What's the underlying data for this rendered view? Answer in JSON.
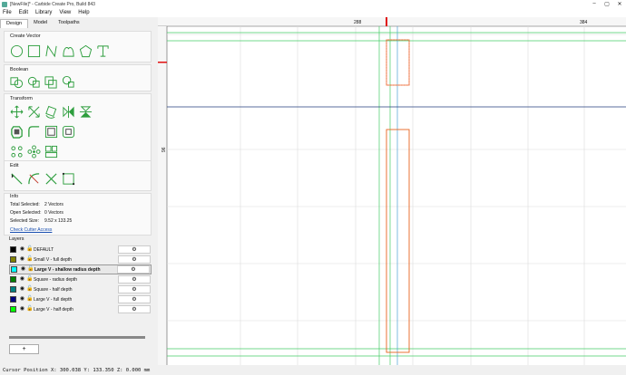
{
  "window": {
    "title": "[NewFile]* - Carbide Create Pro, Build 843",
    "buttons": [
      "–",
      "▢",
      "✕"
    ]
  },
  "menu": [
    "File",
    "Edit",
    "Library",
    "View",
    "Help"
  ],
  "tabs": [
    {
      "label": "Design",
      "active": true
    },
    {
      "label": "Model",
      "active": false
    },
    {
      "label": "Toolpaths",
      "active": false
    }
  ],
  "sections": {
    "create_vector": "Create Vector",
    "boolean": "Boolean",
    "transform": "Transform",
    "edit": "Edit",
    "info": "Info",
    "layers": "Layers"
  },
  "info": {
    "total_selected_label": "Total Selected:",
    "total_selected_value": "2 Vectors",
    "open_selected_label": "Open Selected:",
    "open_selected_value": "0 Vectors",
    "selected_size_label": "Selected Size:",
    "selected_size_value": "9.52 x 133.25",
    "check_cutter_access": "Check Cutter Access"
  },
  "layers": [
    {
      "name": "DEFAULT",
      "color": "#000000",
      "selected": false
    },
    {
      "name": "Small V - full depth",
      "color": "#808000",
      "selected": false
    },
    {
      "name": "Large V - shallow radius depth",
      "color": "#00ffff",
      "selected": true
    },
    {
      "name": "Square - radius depth",
      "color": "#008000",
      "selected": false
    },
    {
      "name": "Square - half depth",
      "color": "#008080",
      "selected": false
    },
    {
      "name": "Large V - full depth",
      "color": "#000080",
      "selected": false
    },
    {
      "name": "Large V - half depth",
      "color": "#00ff00",
      "selected": false
    }
  ],
  "layer_settings_icon": "gear-icon",
  "add_layer_label": "+",
  "ruler": {
    "top_labels": [
      "288",
      "384"
    ],
    "left_labels": [
      "96"
    ]
  },
  "status": "Cursor Position X: 300.038 Y: 133.350 Z: 0.000 mm",
  "colors": {
    "accent_green": "#2e9e3e",
    "selection_orange": "#e8641e",
    "cursor_red": "#e01010"
  }
}
